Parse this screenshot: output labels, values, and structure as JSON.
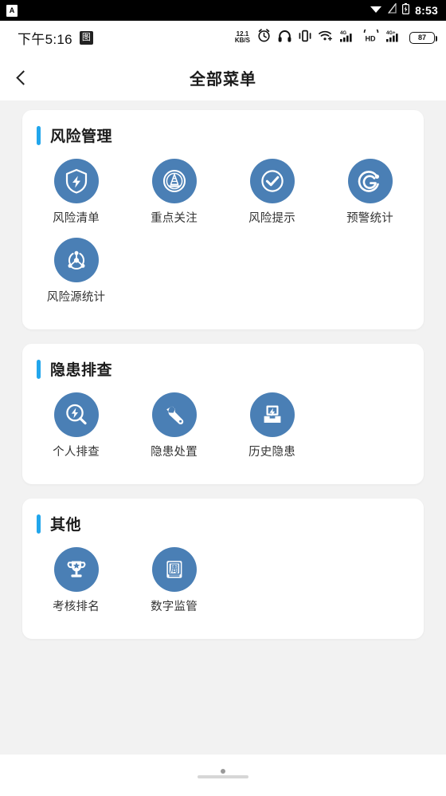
{
  "system_bar": {
    "notification_icon": "app-notification-icon",
    "notification_letter": "A",
    "icons": [
      "wifi-icon",
      "signal-off-icon",
      "battery-charging-icon"
    ],
    "time": "8:53"
  },
  "app_status_bar": {
    "clock": "下午5:16",
    "clock_glyph_icon": "app-glyph-icon",
    "clock_glyph_char": "图",
    "network_speed_value": "12.1",
    "network_speed_unit": "KB/S",
    "icons": [
      "alarm-icon",
      "headphones-icon",
      "vibrate-icon",
      "wifi-plus-icon",
      "signal-4g-icon",
      "hd-icon",
      "signal-4gplus-icon"
    ],
    "hd_label": "HD",
    "signal_4g_label": "4G",
    "signal_4gplus_label": "4G+",
    "battery_level": "87"
  },
  "navbar": {
    "back_icon": "back-chevron-icon",
    "title": "全部菜单"
  },
  "accent_color": "#22a6ec",
  "icon_circle_color": "#4a7fb5",
  "sections": [
    {
      "title": "风险管理",
      "items": [
        {
          "label": "风险清单",
          "icon": "shield-bolt-icon"
        },
        {
          "label": "重点关注",
          "icon": "traffic-cone-icon"
        },
        {
          "label": "风险提示",
          "icon": "check-circle-icon"
        },
        {
          "label": "预警统计",
          "icon": "spiral-target-icon"
        },
        {
          "label": "风险源统计",
          "icon": "network-nodes-icon"
        }
      ]
    },
    {
      "title": "隐患排查",
      "items": [
        {
          "label": "个人排查",
          "icon": "magnifier-bolt-icon"
        },
        {
          "label": "隐患处置",
          "icon": "wrench-icon"
        },
        {
          "label": "历史隐患",
          "icon": "archive-bolt-icon"
        }
      ]
    },
    {
      "title": "其他",
      "items": [
        {
          "label": "考核排名",
          "icon": "trophy-star-icon"
        },
        {
          "label": "数字监管",
          "icon": "zhou-book-icon"
        }
      ]
    }
  ],
  "home_indicator": {
    "dot_icon": "home-dot-icon",
    "bar_icon": "home-indicator-bar"
  }
}
